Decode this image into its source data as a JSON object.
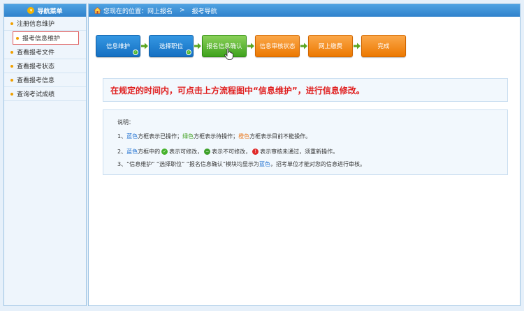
{
  "sidebar": {
    "title": "导航菜单",
    "items": [
      {
        "label": "注册信息维护"
      },
      {
        "label": "报考信息维护"
      },
      {
        "label": "查看报考文件"
      },
      {
        "label": "查看报考状态"
      },
      {
        "label": "查看报考信息"
      },
      {
        "label": "查询考试成绩"
      }
    ]
  },
  "breadcrumb": {
    "prefix": "您现在的位置：网上报名",
    "separator": ">",
    "current": "报考导航"
  },
  "flow": {
    "steps": [
      {
        "label": "信息维护",
        "color": "#1f7fd4"
      },
      {
        "label": "选择职位",
        "color": "#1f7fd4"
      },
      {
        "label": "报名信息确认",
        "color": "#4fb32a"
      },
      {
        "label": "信息审核状态",
        "color": "#f08a12"
      },
      {
        "label": "网上缴费",
        "color": "#f08a12"
      },
      {
        "label": "完成",
        "color": "#f08a12"
      }
    ]
  },
  "notice": "在规定的时间内，可点击上方流程图中“信息维护”，进行信息修改。",
  "explanation": {
    "title": "说明：",
    "line1": {
      "n": "1、",
      "a": "蓝色",
      "b": "方框表示已操作；",
      "c": "绿色",
      "d": "方框表示待操作；",
      "e": "橙色",
      "f": "方框表示目前不能操作。"
    },
    "line2": {
      "n": "2、",
      "a": "蓝色",
      "b": "方框中的",
      "c": "表示可修改，",
      "d": "表示不可修改，",
      "e": "表示审核未通过，须重新操作。"
    },
    "line3": {
      "n": "3、",
      "a": "“信息维护” “选择职位” “报名信息确认”模块均显示为",
      "b": "蓝色",
      "c": "，招考单位才能对您的信息进行审核。"
    }
  }
}
